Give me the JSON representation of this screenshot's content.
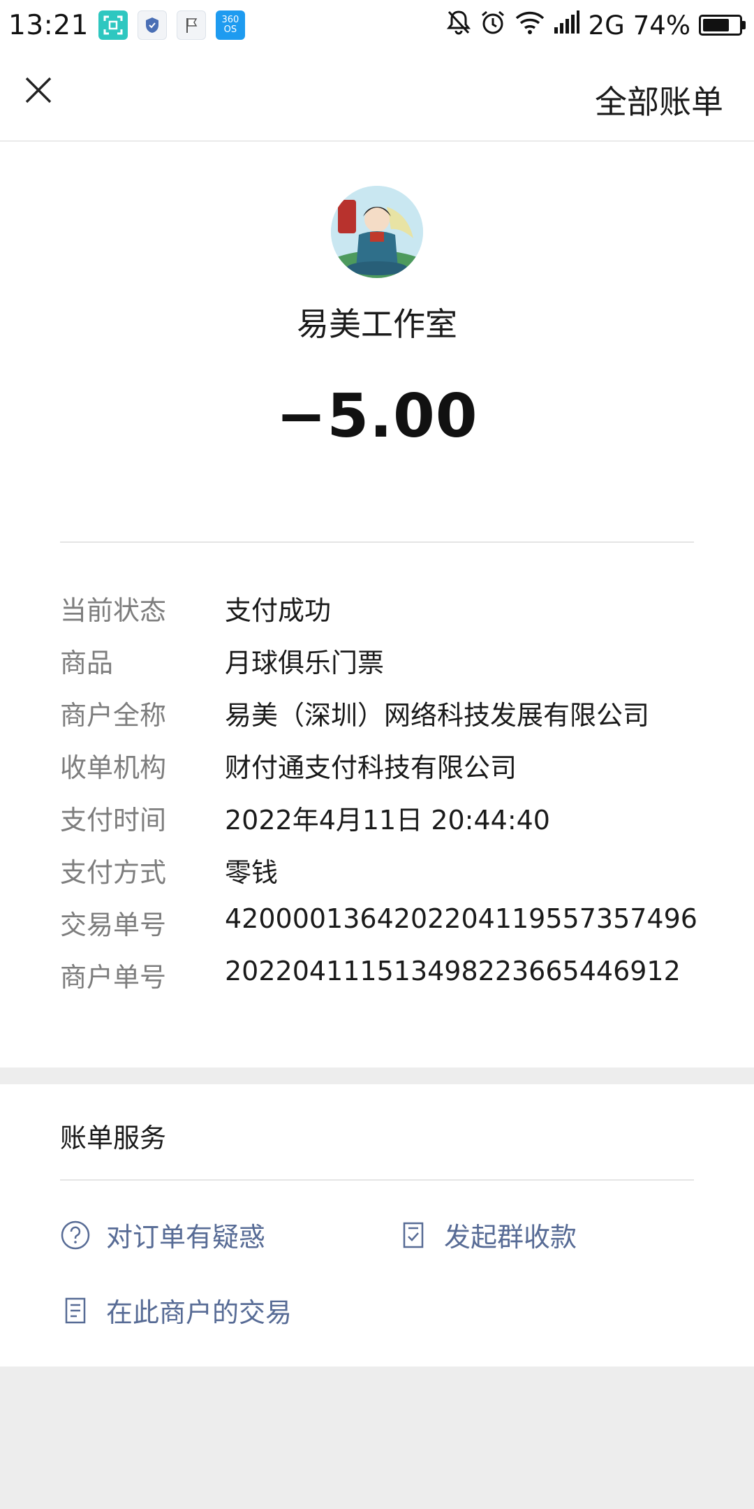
{
  "status_bar": {
    "time": "13:21",
    "network": "2G",
    "battery_percent": "74%",
    "battery_level": 0.74,
    "badge_360_top": "360",
    "badge_360_bottom": "OS"
  },
  "nav": {
    "close_icon": "close-icon",
    "all_bills_label": "全部账单"
  },
  "merchant": {
    "name": "易美工作室",
    "amount": "−5.00"
  },
  "details": [
    {
      "label": "当前状态",
      "value": "支付成功"
    },
    {
      "label": "商品",
      "value": "月球俱乐门票"
    },
    {
      "label": "商户全称",
      "value": "易美（深圳）网络科技发展有限公司"
    },
    {
      "label": "收单机构",
      "value": "财付通支付科技有限公司"
    },
    {
      "label": "支付时间",
      "value": "2022年4月11日 20:44:40"
    },
    {
      "label": "支付方式",
      "value": "零钱"
    },
    {
      "label": "交易单号",
      "value": "4200001364202204119557357496"
    },
    {
      "label": "商户单号",
      "value": "20220411151349822366544691​2"
    }
  ],
  "service": {
    "title": "账单服务",
    "links": {
      "doubt": "对订单有疑惑",
      "group_collect": "发起群收款",
      "merchant_history": "在此商户的交易"
    }
  },
  "colors": {
    "link_blue": "#576b95",
    "page_bg": "#ededed",
    "label_gray": "#7d7d7d"
  }
}
